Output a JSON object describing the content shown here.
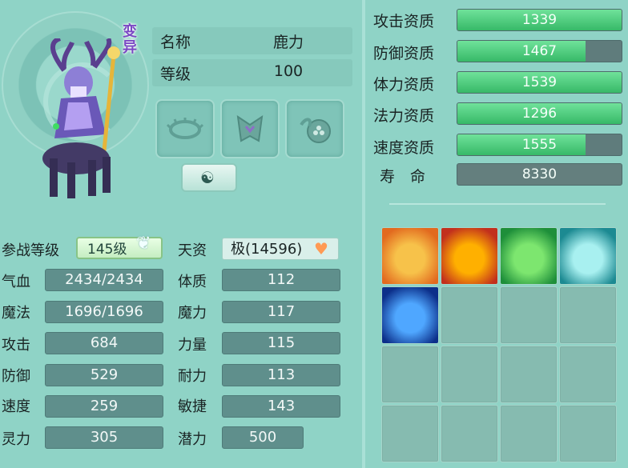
{
  "pet": {
    "mutant_badge": "变异",
    "name_label": "名称",
    "name": "鹿力",
    "level_label": "等级",
    "level": "100"
  },
  "equipment": [
    {
      "icon": "collar-icon"
    },
    {
      "icon": "armor-icon"
    },
    {
      "icon": "paw-charm-icon"
    }
  ],
  "yinyang_button": "☯",
  "battle_level": {
    "label": "参战等级",
    "value": "145级"
  },
  "talent": {
    "label": "天资",
    "value": "极(14596)"
  },
  "left_stats": [
    {
      "label": "气血",
      "value": "2434/2434"
    },
    {
      "label": "魔法",
      "value": "1696/1696"
    },
    {
      "label": "攻击",
      "value": "684"
    },
    {
      "label": "防御",
      "value": "529"
    },
    {
      "label": "速度",
      "value": "259"
    },
    {
      "label": "灵力",
      "value": "305"
    }
  ],
  "right_stats": [
    {
      "label": "体质",
      "value": "112"
    },
    {
      "label": "魔力",
      "value": "117"
    },
    {
      "label": "力量",
      "value": "115"
    },
    {
      "label": "耐力",
      "value": "113"
    },
    {
      "label": "敏捷",
      "value": "143"
    },
    {
      "label": "潜力",
      "value": "500"
    }
  ],
  "qualities": [
    {
      "label": "攻击资质",
      "value": "1339",
      "fill": 1.0
    },
    {
      "label": "防御资质",
      "value": "1467",
      "fill": 0.78
    },
    {
      "label": "体力资质",
      "value": "1539",
      "fill": 1.0
    },
    {
      "label": "法力资质",
      "value": "1296",
      "fill": 1.0
    },
    {
      "label": "速度资质",
      "value": "1555",
      "fill": 0.78
    }
  ],
  "life": {
    "label": "寿　命",
    "value": "8330"
  },
  "skills": [
    {
      "icon": "hourglass-skill-icon",
      "colors": [
        "#f7c24a",
        "#e26a1f"
      ]
    },
    {
      "icon": "demon-mask-skill-icon",
      "colors": [
        "#ffb000",
        "#c2301d"
      ]
    },
    {
      "icon": "muscle-man-skill-icon",
      "colors": [
        "#7de66f",
        "#1e8f3a"
      ]
    },
    {
      "icon": "green-swirl-skill-icon",
      "colors": [
        "#a8f0f0",
        "#1c8a92"
      ]
    },
    {
      "icon": "water-pillar-skill-icon",
      "colors": [
        "#4fa7ff",
        "#0c2f8a"
      ]
    }
  ],
  "skill_slots_total": 16
}
